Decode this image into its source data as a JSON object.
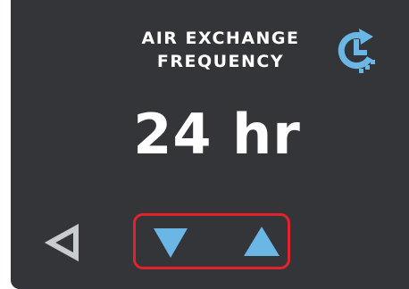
{
  "screen": {
    "title_line1": "AIR EXCHANGE",
    "title_line2": "FREQUENCY",
    "value": "24 hr"
  },
  "icons": {
    "schedule": "clock-history-icon",
    "back": "back-arrow-icon",
    "decrease": "triangle-down-icon",
    "increase": "triangle-up-icon"
  },
  "colors": {
    "background": "#333538",
    "text": "#ffffff",
    "accent": "#6ab7e6",
    "back_icon": "#c8cbcf",
    "highlight_border": "#e3232c"
  }
}
